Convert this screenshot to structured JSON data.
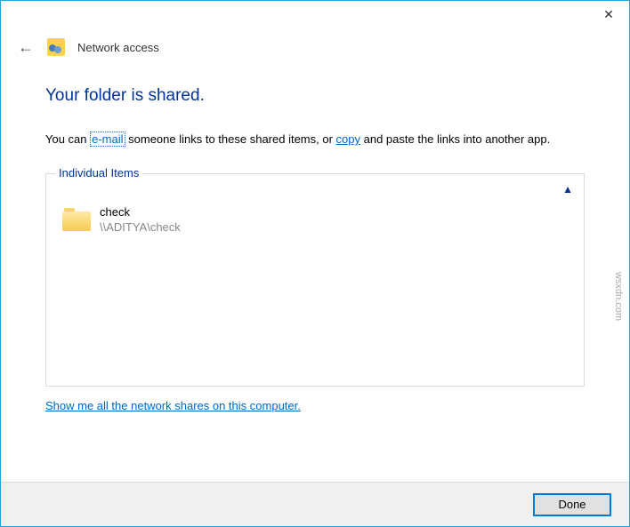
{
  "titlebar": {
    "close_symbol": "✕"
  },
  "header": {
    "back_symbol": "←",
    "title": "Network access"
  },
  "main": {
    "heading": "Your folder is shared.",
    "desc_prefix": "You can ",
    "email_link": "e-mail",
    "desc_mid": " someone links to these shared items, or ",
    "copy_link": "copy",
    "desc_suffix": " and paste the links into another app."
  },
  "group": {
    "label": "Individual Items",
    "chevron": "▲",
    "items": [
      {
        "name": "check",
        "path": "\\\\ADITYA\\check"
      }
    ]
  },
  "show_all_link": "Show me all the network shares on this computer.",
  "footer": {
    "done_label": "Done"
  },
  "watermark": "wsxdn.com"
}
